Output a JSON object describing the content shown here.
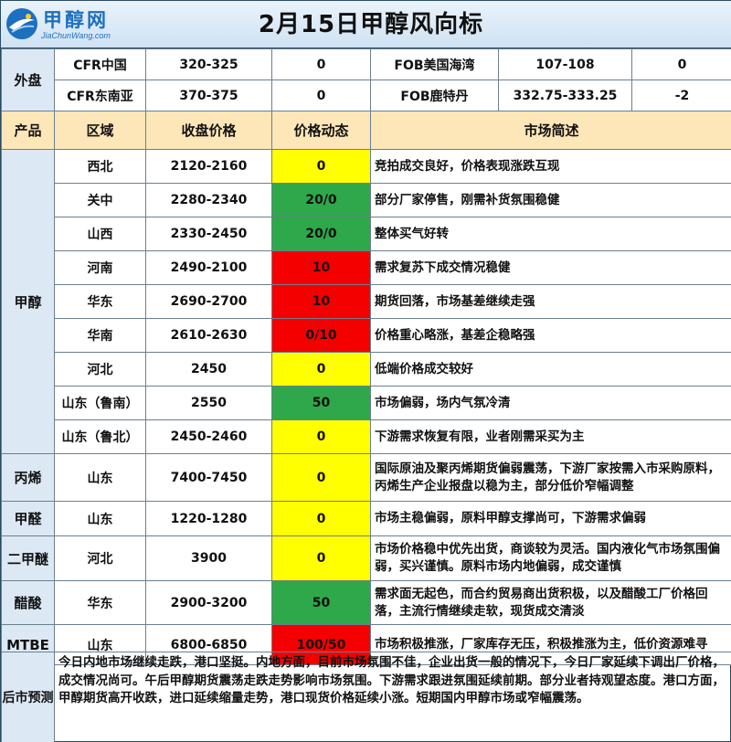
{
  "header": {
    "logo_cn": "甲醇网",
    "logo_en": "JiaChunWang.com",
    "title": "2月15日甲醇风向标"
  },
  "outer_market": {
    "label": "外盘",
    "rows": [
      {
        "a_name": "CFR中国",
        "a_price": "320-325",
        "a_change": "0",
        "b_name": "FOB美国海湾",
        "b_price": "107-108",
        "b_change": "0"
      },
      {
        "a_name": "CFR东南亚",
        "a_price": "370-375",
        "a_change": "0",
        "b_name": "FOB鹿特丹",
        "b_price": "332.75-333.25",
        "b_change": "-2"
      }
    ]
  },
  "columns": [
    "产品",
    "区域",
    "收盘价格",
    "价格动态",
    "市场简述"
  ],
  "products": [
    {
      "name": "甲醇",
      "rows": [
        {
          "region": "西北",
          "price": "2120-2160",
          "change": "0",
          "color": "#ffff00",
          "desc": "竞拍成交良好，价格表现涨跌互现"
        },
        {
          "region": "关中",
          "price": "2280-2340",
          "change": "20/0",
          "color": "#2ea84a",
          "desc": "部分厂家停售，刚需补货氛围稳健"
        },
        {
          "region": "山西",
          "price": "2330-2450",
          "change": "20/0",
          "color": "#2ea84a",
          "desc": "整体买气好转"
        },
        {
          "region": "河南",
          "price": "2490-2100",
          "change": "10",
          "color": "#f40000",
          "desc": "需求复苏下成交情况稳健"
        },
        {
          "region": "华东",
          "price": "2690-2700",
          "change": "10",
          "color": "#f40000",
          "desc": "期货回落，市场基差继续走强"
        },
        {
          "region": "华南",
          "price": "2610-2630",
          "change": "0/10",
          "color": "#f40000",
          "desc": "价格重心略涨，基差企稳略强"
        },
        {
          "region": "河北",
          "price": "2450",
          "change": "0",
          "color": "#ffff00",
          "desc": "低端价格成交较好"
        },
        {
          "region": "山东（鲁南）",
          "price": "2550",
          "change": "50",
          "color": "#2ea84a",
          "desc": "市场偏弱，场内气氛冷清"
        },
        {
          "region": "山东（鲁北）",
          "price": "2450-2460",
          "change": "0",
          "color": "#ffff00",
          "desc": "下游需求恢复有限，业者刚需采买为主"
        }
      ]
    },
    {
      "name": "丙烯",
      "rows": [
        {
          "region": "山东",
          "price": "7400-7450",
          "change": "0",
          "color": "#ffff00",
          "desc": "国际原油及聚丙烯期货偏弱震荡，下游厂家按需入市采购原料，丙烯生产企业报盘以稳为主，部分低价窄幅调整"
        }
      ]
    },
    {
      "name": "甲醛",
      "rows": [
        {
          "region": "山东",
          "price": "1220-1280",
          "change": "0",
          "color": "#ffff00",
          "desc": "市场主稳偏弱，原料甲醇支撑尚可，下游需求偏弱"
        }
      ]
    },
    {
      "name": "二甲醚",
      "rows": [
        {
          "region": "河北",
          "price": "3900",
          "change": "0",
          "color": "#ffff00",
          "desc": "市场价格稳中优先出货，商谈较为灵活。国内液化气市场氛围偏弱，买兴谨慎。原料市场内地偏弱，成交谨慎"
        }
      ]
    },
    {
      "name": "醋酸",
      "rows": [
        {
          "region": "华东",
          "price": "2900-3200",
          "change": "50",
          "color": "#2ea84a",
          "desc": "需求面无起色，而合约贸易商出货积极，以及醋酸工厂价格回落，主流行情继续走软，现货成交清淡"
        }
      ]
    },
    {
      "name": "MTBE",
      "rows": [
        {
          "region": "山东",
          "price": "6800-6850",
          "change": "100/50",
          "color": "#f40000",
          "desc": "市场积极推涨，厂家库存无压，积极推涨为主，低价资源难寻"
        }
      ]
    }
  ],
  "forecast": {
    "label": "后市预测",
    "text": "今日内地市场继续走跌，港口坚挺。内地方面，目前市场氛围不佳，企业出货一般的情况下，今日厂家延续下调出厂价格，成交情况尚可。午后甲醇期货震荡走跌走势影响市场氛围。下游需求跟进氛围延续前期。部分业者持观望态度。港口方面，甲醇期货高开收跌，进口延续缩量走势，港口现货价格延续小涨。短期国内甲醇市场或窄幅震荡。"
  }
}
